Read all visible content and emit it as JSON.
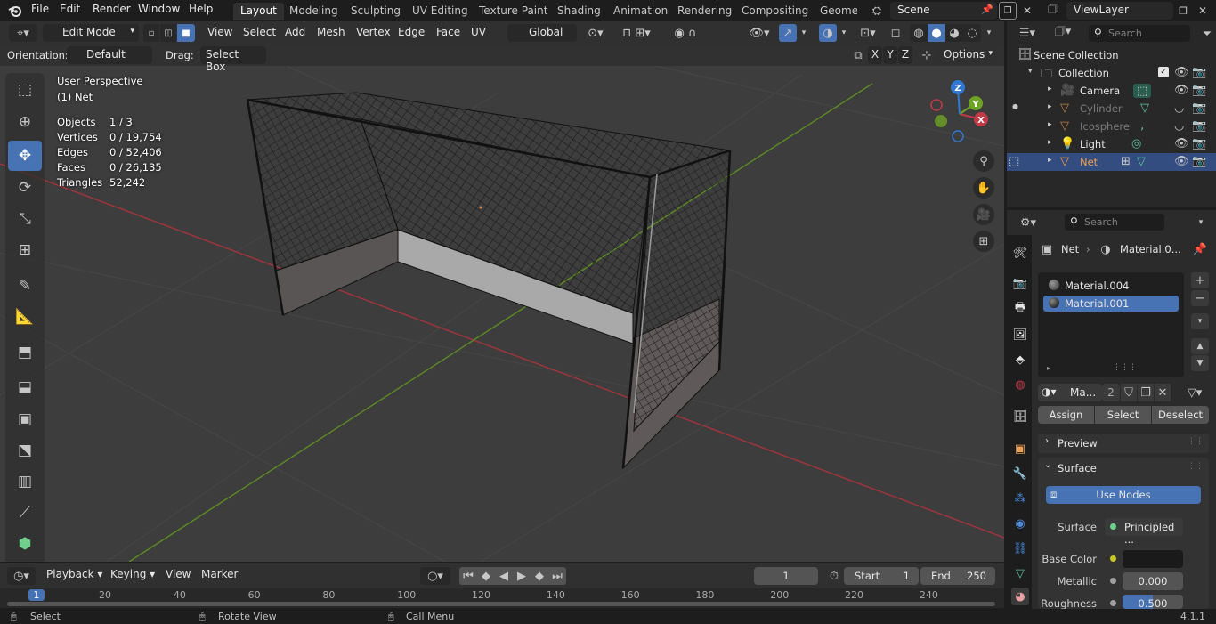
{
  "topbar": {
    "menus": [
      "File",
      "Edit",
      "Render",
      "Window",
      "Help"
    ],
    "workspaces": [
      "Layout",
      "Modeling",
      "Sculpting",
      "UV Editing",
      "Texture Paint",
      "Shading",
      "Animation",
      "Rendering",
      "Compositing",
      "Geomet"
    ],
    "scene": "Scene",
    "view_layer": "ViewLayer"
  },
  "viewport_header": {
    "mode": "Edit Mode",
    "menus": [
      "View",
      "Select",
      "Add",
      "Mesh",
      "Vertex",
      "Edge",
      "Face",
      "UV"
    ],
    "transform": "Global",
    "orientation_label": "Orientation:",
    "orientation_value": "Default",
    "drag_label": "Drag:",
    "drag_value": "Select Box",
    "axes": [
      "X",
      "Y",
      "Z"
    ],
    "options": "Options"
  },
  "stats": {
    "title": "User Perspective",
    "object": "(1) Net",
    "rows": [
      {
        "label": "Objects",
        "value": "1 / 3"
      },
      {
        "label": "Vertices",
        "value": "0 / 19,754"
      },
      {
        "label": "Edges",
        "value": "0 / 52,406"
      },
      {
        "label": "Faces",
        "value": "0 / 26,135"
      },
      {
        "label": "Triangles",
        "value": "52,242"
      }
    ]
  },
  "gizmo": {
    "x": "X",
    "y": "Y",
    "z": "Z"
  },
  "outliner": {
    "search_placeholder": "Search",
    "root": "Scene Collection",
    "collection": "Collection",
    "items": [
      {
        "name": "Camera",
        "color": "#e6e6e6"
      },
      {
        "name": "Cylinder",
        "color": "#7a7a7a"
      },
      {
        "name": "Icosphere",
        "color": "#7a7a7a"
      },
      {
        "name": "Light",
        "color": "#e6e6e6"
      },
      {
        "name": "Net",
        "color": "#f0a050"
      }
    ]
  },
  "properties": {
    "search_placeholder": "Search",
    "breadcrumb_object": "Net",
    "breadcrumb_material": "Material.0...",
    "slots": [
      "Material.004",
      "Material.001"
    ],
    "material_name": "Ma...",
    "user_count": "2",
    "assign": "Assign",
    "select": "Select",
    "deselect": "Deselect",
    "preview": "Preview",
    "surface_panel": "Surface",
    "use_nodes": "Use Nodes",
    "surface_label": "Surface",
    "surface_value": "Principled ...",
    "base_color_label": "Base Color",
    "metallic_label": "Metallic",
    "metallic_value": "0.000",
    "roughness_label": "Roughness",
    "roughness_value": "0.500",
    "roughness_fraction": 0.5
  },
  "timeline": {
    "menus": [
      "Playback",
      "Keying",
      "View",
      "Marker"
    ],
    "current_frame": "1",
    "start_label": "Start",
    "start_value": "1",
    "end_label": "End",
    "end_value": "250",
    "ticks": [
      "1",
      "20",
      "40",
      "60",
      "80",
      "100",
      "120",
      "140",
      "160",
      "180",
      "200",
      "220",
      "240"
    ]
  },
  "statusbar": {
    "select": "Select",
    "rotate": "Rotate View",
    "call_menu": "Call Menu",
    "version": "4.1.1"
  },
  "colors": {
    "accent": "#4772b3",
    "x_axis": "#c23a45",
    "y_axis": "#6fa325",
    "z_axis": "#2f79d4"
  }
}
